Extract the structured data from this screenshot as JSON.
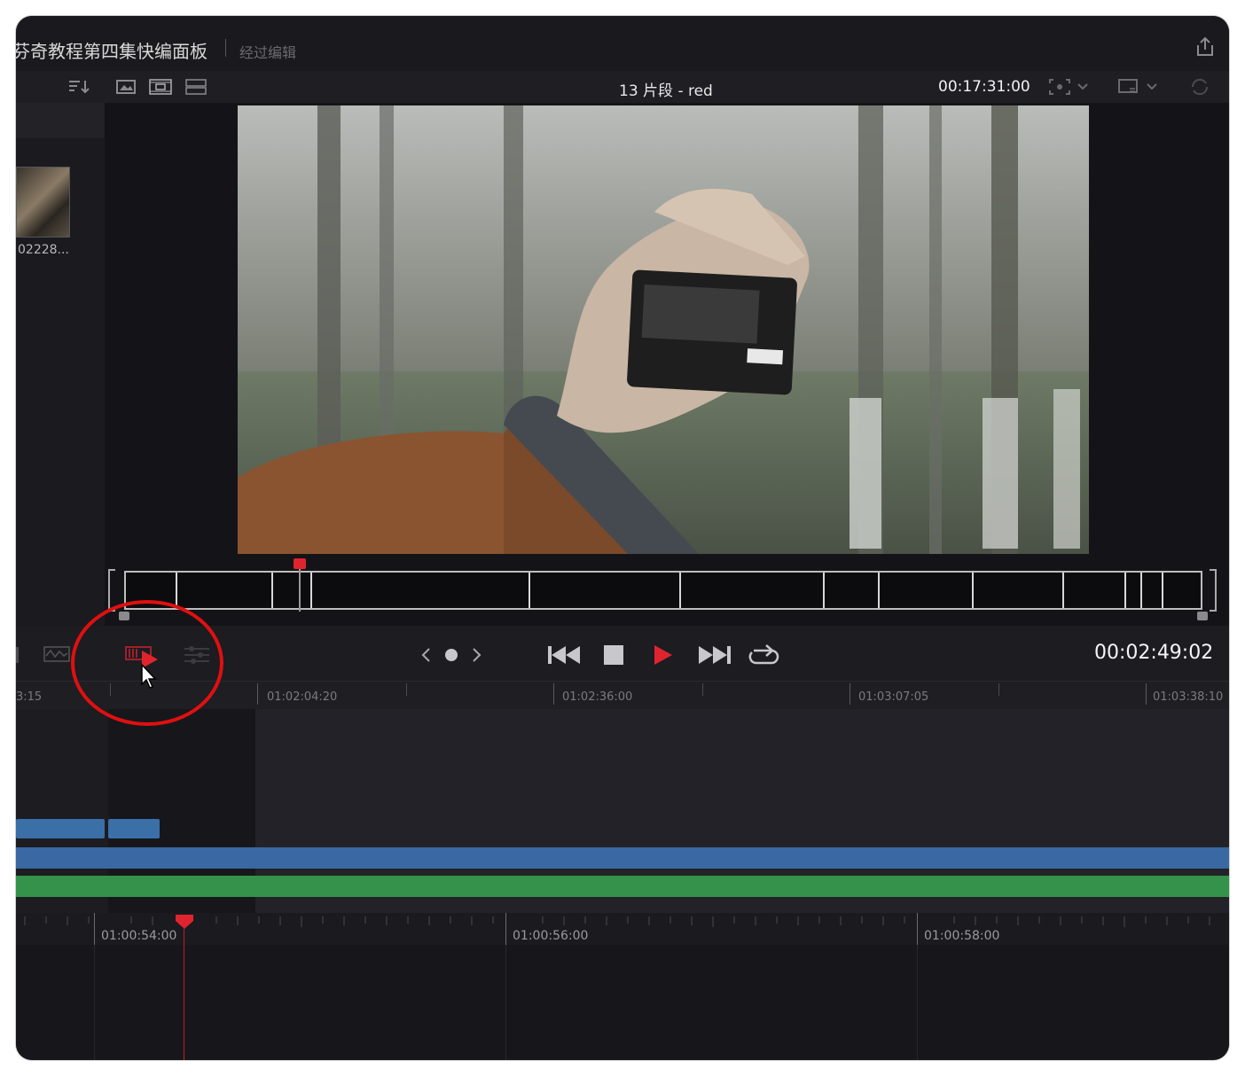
{
  "window": {
    "project_title": "芬奇教程第四集快编面板",
    "edit_state": "经过编辑"
  },
  "toolbar": {
    "clip_name": "13 片段 - red",
    "duration": "00:17:31:00",
    "icons": [
      "sort-icon",
      "thumbnail-view-icon",
      "filmstrip-view-icon",
      "list-view-icon",
      "fullscreen-icon",
      "viewer-layout-icon",
      "sync-icon",
      "share-icon"
    ]
  },
  "media_pool": {
    "clip_label": "02228..."
  },
  "transport": {
    "timecode": "00:02:49:02",
    "controls": [
      "prev-edit-icon",
      "mark-dot-icon",
      "next-edit-icon",
      "skip-to-start-icon",
      "stop-icon",
      "play-icon",
      "skip-to-end-icon",
      "loop-icon"
    ]
  },
  "upper_ruler": {
    "labels": [
      "3:15",
      "01:02:04:20",
      "01:02:36:00",
      "01:03:07:05",
      "01:03:38:10"
    ]
  },
  "lower_ruler": {
    "labels": [
      "01:00:54:00",
      "01:00:56:00",
      "01:00:58:00"
    ]
  },
  "colors": {
    "accent_red": "#e0242e",
    "video_track": "#3968a3",
    "audio_track": "#34924a",
    "annotation": "#e01010"
  }
}
